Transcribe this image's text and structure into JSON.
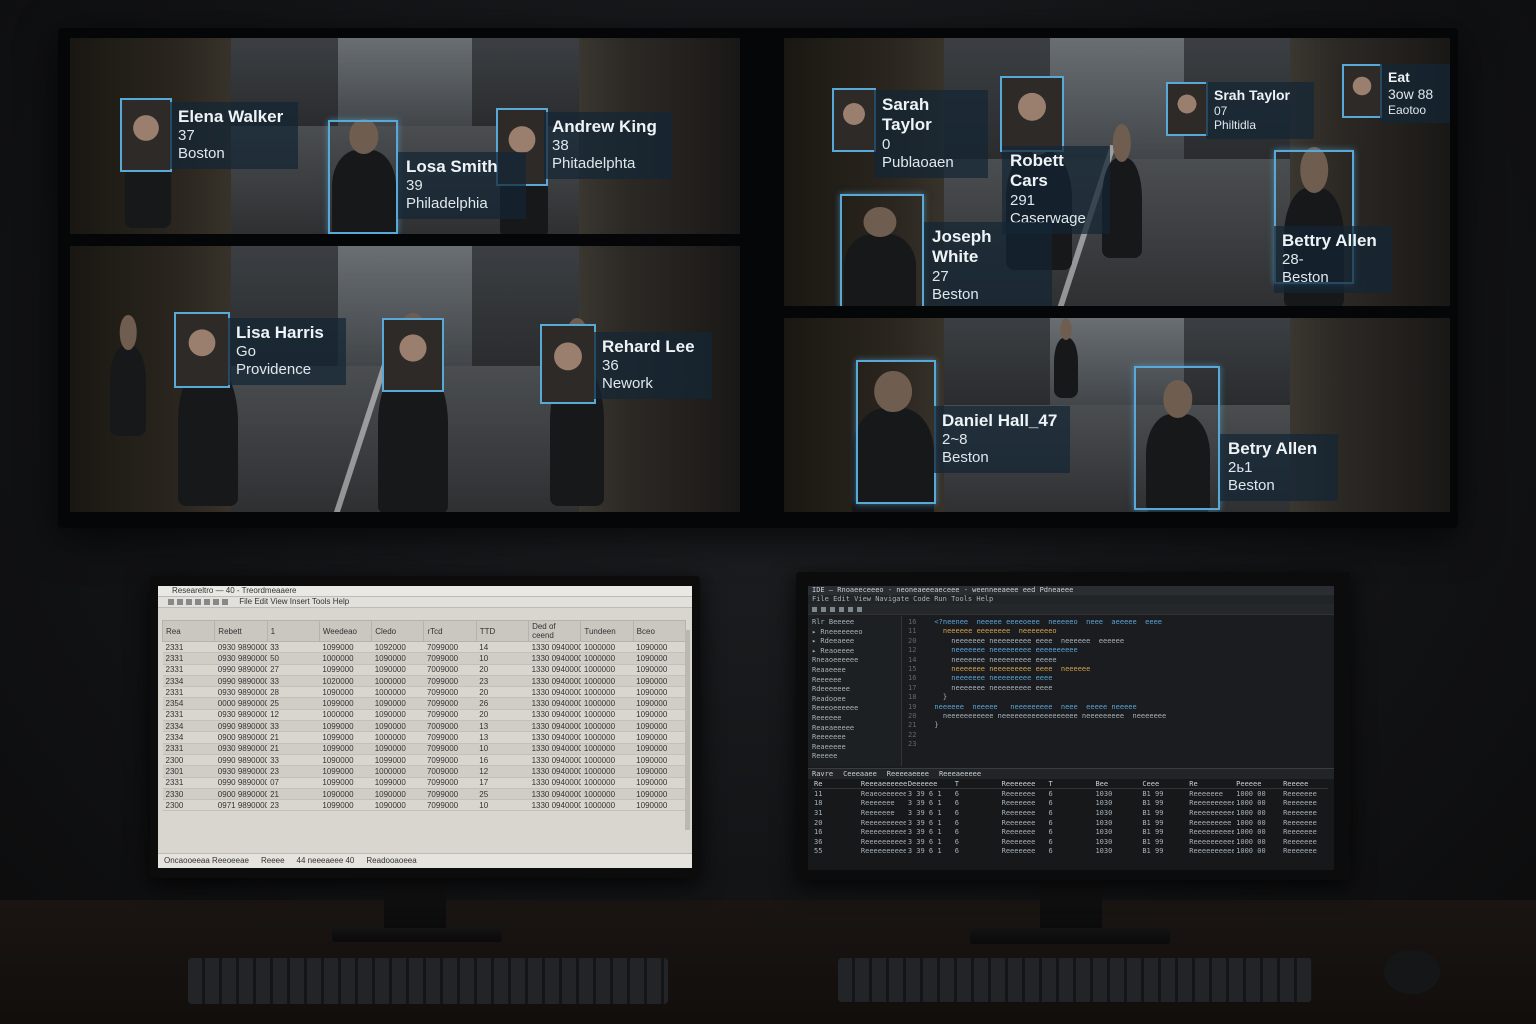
{
  "wall": {
    "feed1": {
      "people": [
        {
          "name": "Elena Walker",
          "age": "37",
          "city": "Boston"
        },
        {
          "name": "Losa Smith",
          "age": "39",
          "city": "Philadelphia"
        },
        {
          "name": "Andrew King",
          "age": "38",
          "city": "Phitadelphta"
        }
      ]
    },
    "feed2": {
      "people": [
        {
          "name": "Sarah Taylor",
          "age": "0",
          "city": "Publaoaen"
        },
        {
          "name": "Srah Taylor",
          "age": "07",
          "city": "Philtidla"
        },
        {
          "name": "Eat",
          "age": "3ow 88",
          "city": "Eaotoo"
        },
        {
          "name": "Robett Cars",
          "age": "291",
          "city": "Caserwage"
        },
        {
          "name": "Joseph White",
          "age": "27",
          "city": "Beston"
        },
        {
          "name": "Bettry Allen",
          "age": "28-",
          "city": "Beston"
        }
      ]
    },
    "feed3": {
      "people": [
        {
          "name": "Lisa Harris",
          "age": "Go",
          "city": "Providence"
        },
        {
          "name": "Rehard Lee",
          "age": "36",
          "city": "Nework"
        }
      ]
    },
    "feed4": {
      "people": [
        {
          "name": "Daniel Hall_47",
          "age": "2~8",
          "city": "Beston"
        },
        {
          "name": "Betry Allen",
          "age": "2ь1",
          "city": "Beston"
        }
      ]
    }
  },
  "left_monitor": {
    "title": "Researeltro — 40 - Treordmeaaere",
    "menu": "File  Edit  View  Insert  Tools  Help",
    "columns": [
      "Rea",
      "Rebett",
      "1",
      "Weedeao",
      "Cledo",
      "rTcd",
      "TTD",
      "Ded of ceend",
      "Tundeen",
      "Bceo"
    ],
    "rows": [
      [
        "2331",
        "0930 9890000",
        "33",
        "1099000",
        "1092000",
        "7099000",
        "14",
        "1330 0940000",
        "1000000",
        "1090000"
      ],
      [
        "2331",
        "0930 9890000",
        "50",
        "1000000",
        "1090000",
        "7099000",
        "10",
        "1330 0940000",
        "1000000",
        "1090000"
      ],
      [
        "2331",
        "0990 9890000",
        "27",
        "1099000",
        "1090000",
        "7009000",
        "20",
        "1330 0940000",
        "1000000",
        "1090000"
      ],
      [
        "2334",
        "0990 9890000",
        "33",
        "1020000",
        "1000000",
        "7099000",
        "23",
        "1330 0940000",
        "1000000",
        "1090000"
      ],
      [
        "2331",
        "0930 9890000",
        "28",
        "1090000",
        "1000000",
        "7099000",
        "20",
        "1330 0940000",
        "1000000",
        "1090000"
      ],
      [
        "2354",
        "0000 9890000",
        "25",
        "1099000",
        "1090000",
        "7099000",
        "26",
        "1330 0940000",
        "1000000",
        "1090000"
      ],
      [
        "2331",
        "0930 9890000",
        "12",
        "1000000",
        "1090000",
        "7099000",
        "20",
        "1330 0940000",
        "1000000",
        "1090000"
      ],
      [
        "2334",
        "0990 9890000",
        "33",
        "1099000",
        "1090000",
        "7009000",
        "13",
        "1330 0940000",
        "1000000",
        "1090000"
      ],
      [
        "2334",
        "0900 9890000",
        "21",
        "1099000",
        "1000000",
        "7099000",
        "13",
        "1330 0940000",
        "1000000",
        "1090000"
      ],
      [
        "2331",
        "0930 9890000",
        "21",
        "1099000",
        "1090000",
        "7099000",
        "10",
        "1330 0940000",
        "1000000",
        "1090000"
      ],
      [
        "2300",
        "0990 9890000",
        "33",
        "1090000",
        "1099000",
        "7099000",
        "16",
        "1330 0940000",
        "1000000",
        "1090000"
      ],
      [
        "2301",
        "0930 9890000",
        "23",
        "1099000",
        "1000000",
        "7009000",
        "12",
        "1330 0940000",
        "1000000",
        "1090000"
      ],
      [
        "2331",
        "0990 9890000",
        "07",
        "1099000",
        "1099000",
        "7099000",
        "17",
        "1330 0940000",
        "1000000",
        "1090000"
      ],
      [
        "2330",
        "0900 9890000",
        "21",
        "1090000",
        "1090000",
        "7099000",
        "25",
        "1330 0940000",
        "1000000",
        "1090000"
      ],
      [
        "2300",
        "0971 9890000",
        "23",
        "1099000",
        "1090000",
        "7099000",
        "10",
        "1330 0940000",
        "1000000",
        "1090000"
      ]
    ],
    "status": [
      "Oncaooeeaa Reeoeeae",
      "Reeee",
      "44 neeeaeee 40",
      "Readooaoeea"
    ]
  },
  "right_monitor": {
    "title": "IDE — Rnoaeeceeeo - neoneaeeeaeceee - weenneeaeee eed Pdneaeee",
    "menu": "File  Edit  View  Navigate  Code  Run  Tools  Help",
    "tree": [
      "Rlr Beeeee",
      "▸ Rneeeeeeeo",
      "▸ Rdeeaeee",
      "▸ Reaoeeee",
      "  Rneaoeeeeee",
      "  Reaaeeee",
      "  Reeeeee",
      "  Rdeeeeeee",
      "  Readooee",
      "  Reeeoeeeeee",
      "  Reeeeee",
      "  Reaeaeeeee",
      "  Reeeeeee",
      "  Reaeeeee",
      "  Reeeee"
    ],
    "code": [
      {
        "ln": "16",
        "text": "  <?neenee  neeeee eeeeoeee  neeeeeo  neee  aeeeee  eeee"
      },
      {
        "ln": "11",
        "text": "    neeeeee eeeeeeee  neeeeeeeo"
      },
      {
        "ln": "20",
        "text": "      neeeeeee neeeeeeeee eeee  neeeeee  eeeeee"
      },
      {
        "ln": "12",
        "text": "      neeeeeee neeeeeeeee eeeeeeeeee"
      },
      {
        "ln": "14",
        "text": "      neeeeeee neeeeeeeee eeeee"
      },
      {
        "ln": "15",
        "text": "      neeeeeee neeeeeeeee eeee  neeeeee"
      },
      {
        "ln": "16",
        "text": "      neeeeeee neeeeeeeee eeee"
      },
      {
        "ln": "17",
        "text": "      neeeeeee neeeeeeeee eeee"
      },
      {
        "ln": "18",
        "text": "    }"
      },
      {
        "ln": "19",
        "text": "  neeeeee  neeeee   neeeeeeeee  neee  eeeee neeeee"
      },
      {
        "ln": "20",
        "text": "    neeeeeeeeeee neeeeeeeeeeeeeeeeee neeeeeeeee  neeeeeee"
      },
      {
        "ln": "21",
        "text": "  }"
      },
      {
        "ln": "22",
        "text": ""
      },
      {
        "ln": "23",
        "text": ""
      }
    ],
    "bottom_tabs": [
      "Ravre",
      "Ceeeaaee",
      "Reeeeaeeee",
      "Reeeaeeeee"
    ],
    "columns": [
      "Re",
      "Reeeaeeeeee",
      "Deeeeee",
      "T",
      "Reeeeeee",
      "T",
      "Bee",
      "Ceee",
      "Re",
      "Peeeee",
      "Reeeee"
    ],
    "rows": [
      [
        "11",
        "Reaeoeeeeeee",
        "3 39 6  1",
        "6",
        "Reeeeeee",
        "6",
        "1030",
        "B1 99",
        "Reeeeeee",
        "1000 00",
        "Reeeeeee"
      ],
      [
        "18",
        "Reeeeeee",
        "3 39 6  1",
        "6",
        "Reeeeeee",
        "6",
        "1030",
        "B1 99",
        "Reeeeeeeeee",
        "1000 00",
        "Reeeeeee"
      ],
      [
        "31",
        "Reeeeeee",
        "3 39 6  1",
        "6",
        "Reeeeeee",
        "6",
        "1030",
        "B1 99",
        "Reeeeeeeeee",
        "1000 00",
        "Reeeeeee"
      ],
      [
        "20",
        "Reeeeeeeeeeee",
        "3 39 6  1",
        "6",
        "Reeeeeee",
        "6",
        "1030",
        "B1 99",
        "Reeeeeeeee",
        "1000 00",
        "Reeeeeee"
      ],
      [
        "16",
        "Reeeeeeeeeee",
        "3 39 6  1",
        "6",
        "Reeeeeee",
        "6",
        "1030",
        "B1 99",
        "Reeeeeeeeeeee",
        "1000 00",
        "Reeeeeee"
      ],
      [
        "36",
        "Reeeeeeeeeeeeeee",
        "3 39 6  1",
        "6",
        "Reeeeeee",
        "6",
        "1030",
        "B1 99",
        "Reeeeeeeeeeee",
        "1000 00",
        "Reeeeeee"
      ],
      [
        "55",
        "Reeeeeeeeeeee",
        "3 39 6  1",
        "6",
        "Reeeeeee",
        "6",
        "1030",
        "B1 99",
        "Reeeeeeeeeeee",
        "1000 00",
        "Reeeeeee"
      ]
    ]
  },
  "colors": {
    "box": "#58a9d8",
    "label_bg": "#142634"
  }
}
